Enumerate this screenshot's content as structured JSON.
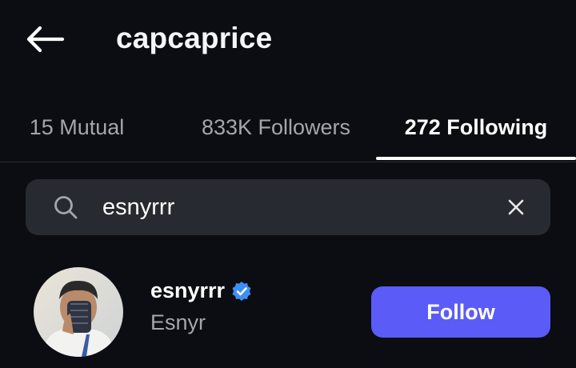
{
  "header": {
    "title": "capcaprice",
    "back_icon": "arrow-left-icon"
  },
  "tabs": [
    {
      "label": "15 Mutual",
      "active": false
    },
    {
      "label": "833K Followers",
      "active": false
    },
    {
      "label": "272 Following",
      "active": true
    }
  ],
  "search": {
    "value": "esnyrrr",
    "icon": "search-icon",
    "clear_icon": "close-icon"
  },
  "results": [
    {
      "username": "esnyrrr",
      "display_name": "Esnyr",
      "verified": true,
      "action_label": "Follow"
    }
  ],
  "colors": {
    "background": "#0b0d12",
    "search_bg": "#272a30",
    "accent": "#5b5bf7",
    "verified": "#3d8ff5",
    "muted_text": "#a3a6ad"
  }
}
